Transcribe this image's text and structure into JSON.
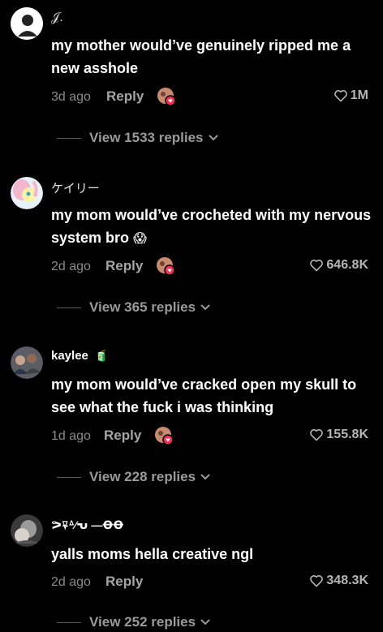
{
  "comments": [
    {
      "username": "𝒥.",
      "text": "my mother would’ve genuinely ripped me a new asshole",
      "age": "3d ago",
      "reply_label": "Reply",
      "likes": "1M",
      "view_replies": "View 1533 replies"
    },
    {
      "username": "ケイリー",
      "text": "my mom would’ve crocheted with my nervous system bro",
      "emoji": "😱",
      "age": "2d ago",
      "reply_label": "Reply",
      "likes": "646.8K",
      "view_replies": "View 365 replies"
    },
    {
      "username": "kaylee",
      "emoji": "🧃",
      "text": "my mom would’ve cracked open my skull to see what the fuck i was thinking",
      "age": "1d ago",
      "reply_label": "Reply",
      "likes": "155.8K",
      "view_replies": "View 228 replies"
    },
    {
      "username": "ᕗ⍫ᐞ⁄ᕃ —ꝊꝊ",
      "text": "yalls moms hella creative ngl",
      "age": "2d ago",
      "reply_label": "Reply",
      "likes": "348.3K",
      "view_replies": "View 252 replies"
    }
  ],
  "colors": {
    "background": "#000000",
    "creator_badge": "#fe2c55"
  }
}
